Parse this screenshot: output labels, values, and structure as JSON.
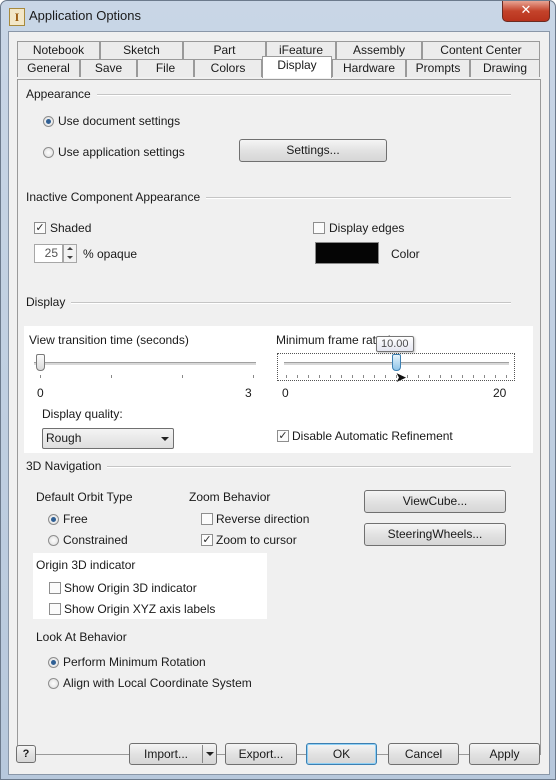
{
  "window": {
    "title": "Application Options",
    "close_glyph": "✕",
    "app_icon": "I"
  },
  "tabs_row1": [
    "Notebook",
    "Sketch",
    "Part",
    "iFeature",
    "Assembly",
    "Content Center"
  ],
  "tabs_row2": [
    "General",
    "Save",
    "File",
    "Colors",
    "Display",
    "Hardware",
    "Prompts",
    "Drawing"
  ],
  "active_tab": "Display",
  "appearance": {
    "label": "Appearance",
    "use_document": "Use document settings",
    "use_application": "Use application settings",
    "selected": "use_document",
    "settings_button": "Settings..."
  },
  "inactive": {
    "label": "Inactive Component Appearance",
    "shaded": "Shaded",
    "shaded_checked": true,
    "opacity_value": "25",
    "opacity_unit": "% opaque",
    "display_edges": "Display edges",
    "display_edges_checked": false,
    "color_label": "Color",
    "color_value": "#050505"
  },
  "display": {
    "label": "Display",
    "view_transition_label": "View transition time (seconds)",
    "view_transition_min": "0",
    "view_transition_max": "3",
    "view_transition_value": 0,
    "min_frame_rate_label": "Minimum frame rate (",
    "min_frame_rate_tooltip": "10.00",
    "min_frame_rate_min": "0",
    "min_frame_rate_max": "20",
    "min_frame_rate_value": 10,
    "display_quality_label": "Display quality:",
    "display_quality_value": "Rough",
    "disable_refinement": "Disable Automatic Refinement",
    "disable_refinement_checked": true
  },
  "nav3d": {
    "label": "3D Navigation",
    "orbit_label": "Default Orbit Type",
    "orbit_free": "Free",
    "orbit_constrained": "Constrained",
    "orbit_selected": "free",
    "zoom_label": "Zoom Behavior",
    "reverse_direction": "Reverse direction",
    "reverse_checked": false,
    "zoom_to_cursor": "Zoom to cursor",
    "zoom_to_cursor_checked": true,
    "viewcube_button": "ViewCube...",
    "steeringwheels_button": "SteeringWheels...",
    "origin_label": "Origin 3D indicator",
    "show_origin": "Show Origin 3D indicator",
    "show_origin_checked": false,
    "show_xyz": "Show Origin XYZ axis labels",
    "show_xyz_checked": false,
    "lookat_label": "Look At Behavior",
    "perform_min_rotation": "Perform Minimum Rotation",
    "align_local": "Align with Local Coordinate System",
    "lookat_selected": "perform_min_rotation"
  },
  "footer": {
    "help_glyph": "?",
    "import": "Import...",
    "export": "Export...",
    "ok": "OK",
    "cancel": "Cancel",
    "apply": "Apply"
  },
  "colors": {
    "highlight": "#ffffff",
    "accent": "#3c7fb1",
    "title_close": "#c4432b"
  }
}
